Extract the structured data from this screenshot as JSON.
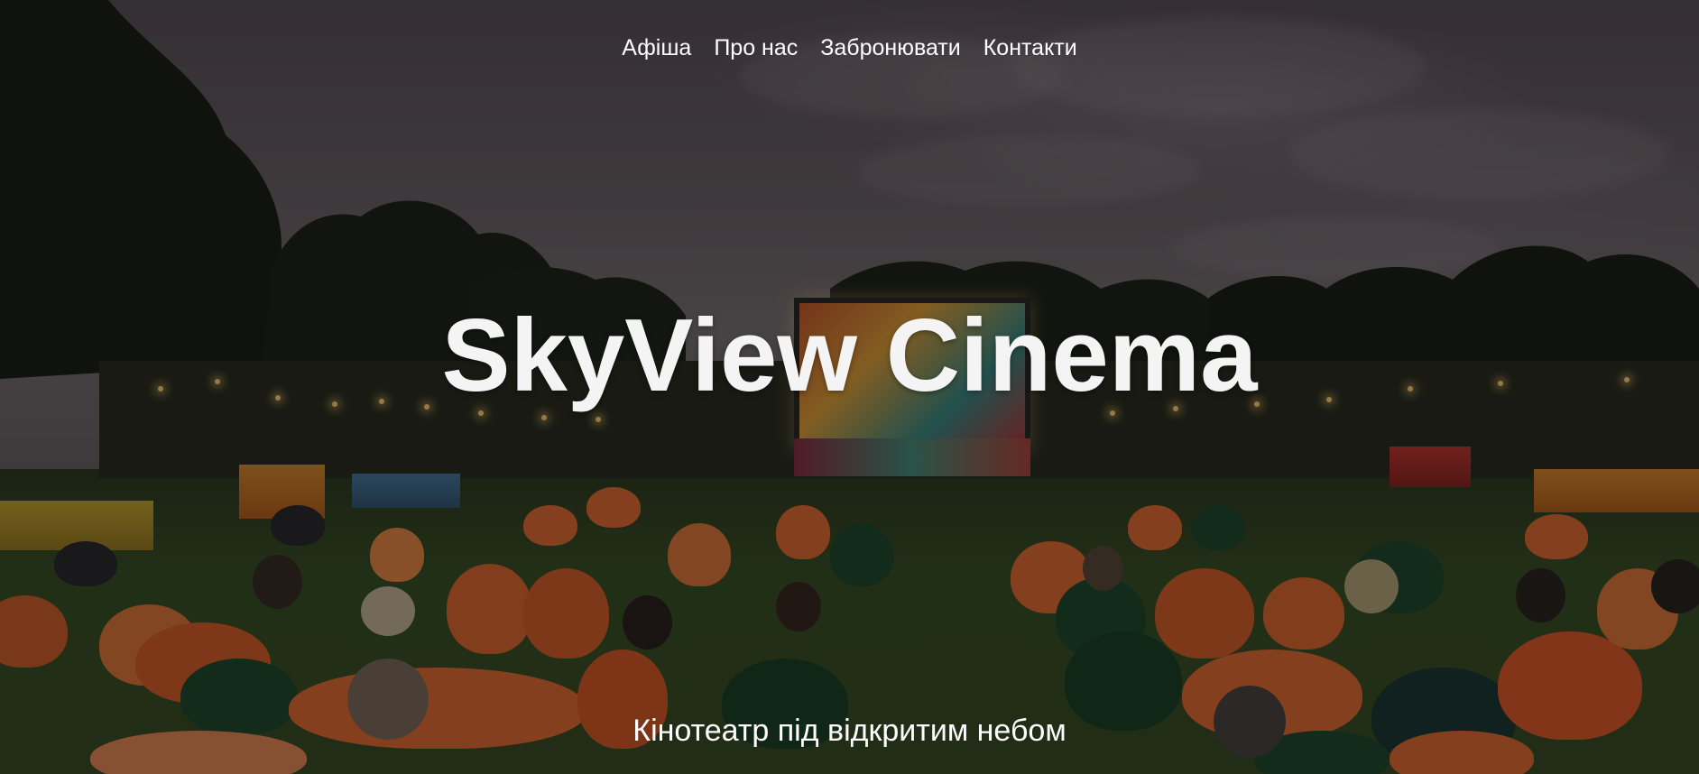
{
  "nav": {
    "items": [
      {
        "label": "Афіша"
      },
      {
        "label": "Про нас"
      },
      {
        "label": "Забронювати"
      },
      {
        "label": "Контакти"
      }
    ]
  },
  "hero": {
    "title": "SkyView Cinema",
    "subtitle": "Кінотеатр під відкритим небом",
    "background_image": "outdoor-cinema-photo"
  },
  "colors": {
    "text": "#ffffff",
    "overlay": "rgba(0,0,0,0.42)"
  }
}
